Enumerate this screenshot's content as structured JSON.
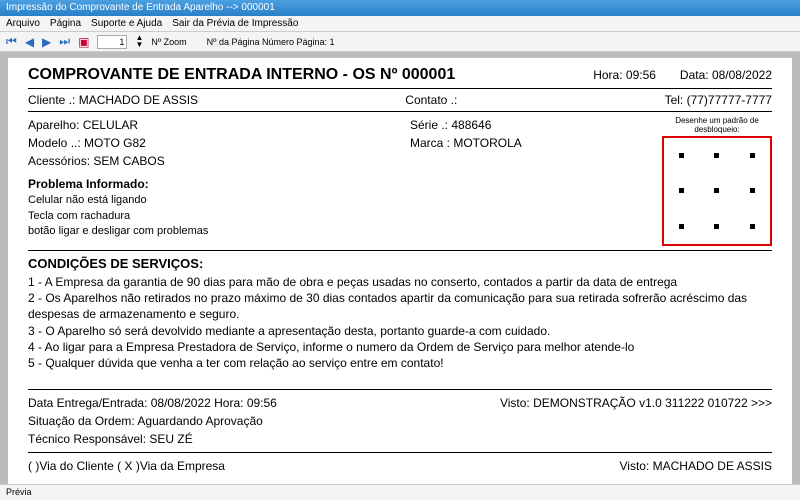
{
  "window": {
    "title": "Impressão do Comprovante de Entrada Aparelho --> 000001"
  },
  "menu": {
    "arquivo": "Arquivo",
    "pagina": "Página",
    "suporte": "Suporte e Ajuda",
    "sair": "Sair da Prévia de Impressão"
  },
  "toolbar": {
    "zoom_value": "1",
    "zoom_label": "Nº Zoom",
    "page_label": "Nº da Página  Número Página: 1"
  },
  "doc": {
    "title": "COMPROVANTE DE ENTRADA INTERNO - OS Nº 000001",
    "hora_label": "Hora: ",
    "hora": "09:56",
    "data_label": "Data: ",
    "data": "08/08/2022",
    "cliente_label": "Cliente   .:",
    "cliente": " MACHADO DE ASSIS",
    "contato_label": "Contato .:",
    "tel_label": "Tel: ",
    "tel": "(77)77777-7777",
    "aparelho_label": "Aparelho: ",
    "aparelho": "CELULAR",
    "serie_label": "Série  .: ",
    "serie": "488646",
    "modelo_label": "Modelo ..: ",
    "modelo": "MOTO G82",
    "marca_label": "Marca : ",
    "marca": "MOTOROLA",
    "acess_label": "Acessórios: ",
    "acess": "SEM CABOS",
    "pattern_label": "Desenhe um padrão de desbloqueio:",
    "prob_title": "Problema Informado:",
    "prob_lines": "Celular não está ligando\nTecla com rachadura\nbotão ligar e desligar com problemas",
    "cond_title": "CONDIÇÕES DE SERVIÇOS:",
    "cond1": "1 - A Empresa da garantia de 90 dias para mão de obra e peças usadas no conserto, contados  a partir da data de entrega",
    "cond2": "2 - Os Aparelhos não retirados no prazo máximo de 30 dias contados apartir da comunicação para sua retirada sofrerão acréscimo das despesas de armazenamento e seguro.",
    "cond3": "3 - O Aparelho só será devolvido mediante a apresentação desta, portanto guarde-a com cuidado.",
    "cond4": "4 - Ao ligar para a Empresa Prestadora de Serviço, informe o numero da Ordem de Serviço para melhor atende-lo",
    "cond5": "5 - Qualquer dúvida que venha a ter com relação ao serviço entre em contato!",
    "entrega": "Data Entrega/Entrada: 08/08/2022   Hora:  09:56",
    "visto1": "Visto: DEMONSTRAÇÃO v1.0 311222 010722 >>>",
    "situacao": "Situação da Ordem: Aguardando Aprovação",
    "tecnico": "Técnico Responsável: SEU ZÉ",
    "via": "(   )Via do Cliente       ( X )Via da Empresa",
    "visto2": "Visto: MACHADO DE ASSIS"
  },
  "status": {
    "text": "Prévia"
  }
}
